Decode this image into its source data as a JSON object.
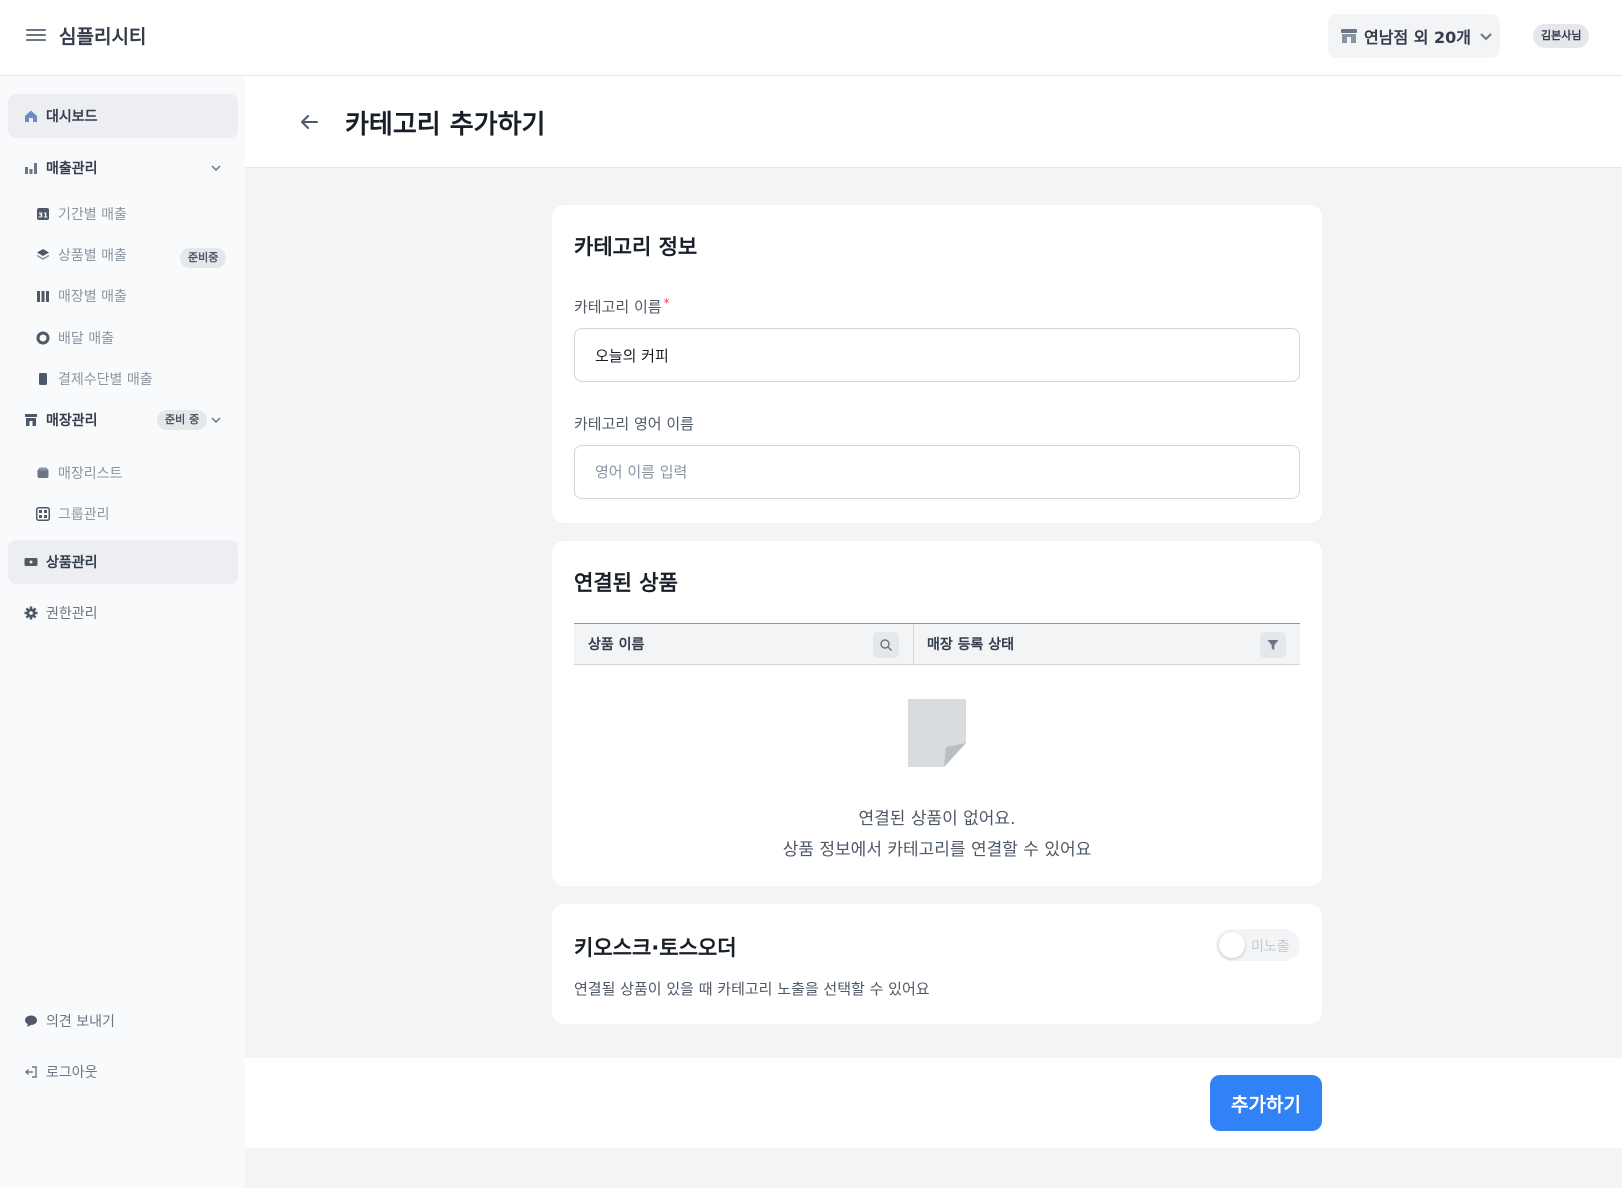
{
  "header": {
    "brand": "심플리시티",
    "store_selector": "연남점 외 20개",
    "user": "김본사님"
  },
  "sidebar": {
    "dashboard": "대시보드",
    "sales": {
      "label": "매출관리",
      "items": [
        "기간별 매출",
        "상품별 매출",
        "매장별 매출",
        "배달 매출",
        "결제수단별 매출"
      ],
      "product_badge": "준비중"
    },
    "stores": {
      "label": "매장관리",
      "badge": "준비 중",
      "items": [
        "매장리스트",
        "그룹관리"
      ]
    },
    "products": "상품관리",
    "permissions": "권한관리",
    "feedback": "의견 보내기",
    "logout": "로그아웃"
  },
  "page": {
    "title": "카테고리 추가하기"
  },
  "category_info": {
    "title": "카테고리 정보",
    "name_label": "카테고리 이름",
    "required_mark": "*",
    "name_value": "오늘의 커피",
    "english_label": "카테고리 영어 이름",
    "english_placeholder": "영어 이름 입력"
  },
  "linked_products": {
    "title": "연결된 상품",
    "columns": [
      "상품 이름",
      "매장 등록 상태"
    ],
    "empty_line1": "연결된 상품이 없어요.",
    "empty_line2": "상품 정보에서 카테고리를 연결할 수 있어요"
  },
  "kiosk": {
    "title": "키오스크·토스오더",
    "toggle_label": "미노출",
    "toggle_on": false,
    "description": "연결될 상품이 있을 때 카테고리 노출을 선택할 수 있어요"
  },
  "footer": {
    "submit": "추가하기"
  },
  "colors": {
    "primary": "#3182f6",
    "required": "#f04452"
  }
}
